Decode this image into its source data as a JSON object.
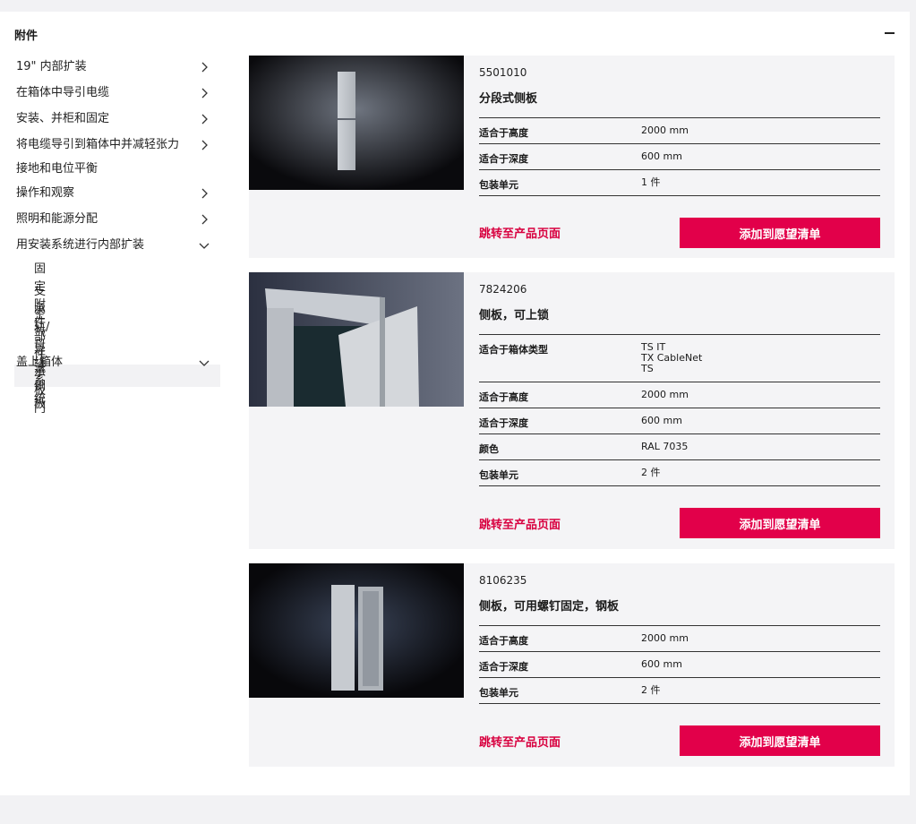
{
  "panel": {
    "title": "附件"
  },
  "sidebar": {
    "items": [
      {
        "label": "19\" 内部扩装",
        "chevron": "right"
      },
      {
        "label": "在箱体中导引电缆",
        "chevron": "right"
      },
      {
        "label": "安装、并柜和固定",
        "chevron": "right"
      },
      {
        "label": "将电缆导引到箱体中并减轻张力",
        "chevron": "right"
      },
      {
        "label": "接地和电位平衡",
        "chevron": "none"
      },
      {
        "label": "操作和观察",
        "chevron": "right"
      },
      {
        "label": "照明和能源分配",
        "chevron": "right"
      },
      {
        "label": "用安装系统进行内部扩装",
        "chevron": "down"
      },
      {
        "label": "盖上箱体",
        "chevron": "down"
      }
    ],
    "sub_install": [
      "固定附件",
      "支承轨/母线系统",
      "空气导流",
      "部件承板"
    ],
    "sub_cover": [
      "侧板",
      "门"
    ],
    "active": "侧板"
  },
  "products": [
    {
      "number": "5501010",
      "name": "分段式侧板",
      "specs": [
        {
          "key": "适合于高度",
          "value": "2000 mm"
        },
        {
          "key": "适合于深度",
          "value": "600 mm"
        },
        {
          "key": "包装单元",
          "value": "1 件"
        }
      ],
      "link": "跳转至产品页面",
      "cta": "添加到愿望清单"
    },
    {
      "number": "7824206",
      "name": "侧板，可上锁",
      "specs": [
        {
          "key": "适合于箱体类型",
          "value": "TS IT\nTX CableNet\nTS"
        },
        {
          "key": "适合于高度",
          "value": "2000 mm"
        },
        {
          "key": "适合于深度",
          "value": "600 mm"
        },
        {
          "key": "颜色",
          "value": "RAL 7035"
        },
        {
          "key": "包装单元",
          "value": "2 件"
        }
      ],
      "link": "跳转至产品页面",
      "cta": "添加到愿望清单"
    },
    {
      "number": "8106235",
      "name": "侧板，可用螺钉固定，钢板",
      "specs": [
        {
          "key": "适合于高度",
          "value": "2000 mm"
        },
        {
          "key": "适合于深度",
          "value": "600 mm"
        },
        {
          "key": "包装单元",
          "value": "2 件"
        }
      ],
      "link": "跳转至产品页面",
      "cta": "添加到愿望清单"
    }
  ],
  "colors": {
    "accent": "#e2004a",
    "link": "#d8003f",
    "card_bg": "#f4f4f6"
  },
  "icons": {
    "collapse": "minus-icon",
    "chevron_right": "chevron-right-icon",
    "chevron_down": "chevron-down-icon"
  }
}
